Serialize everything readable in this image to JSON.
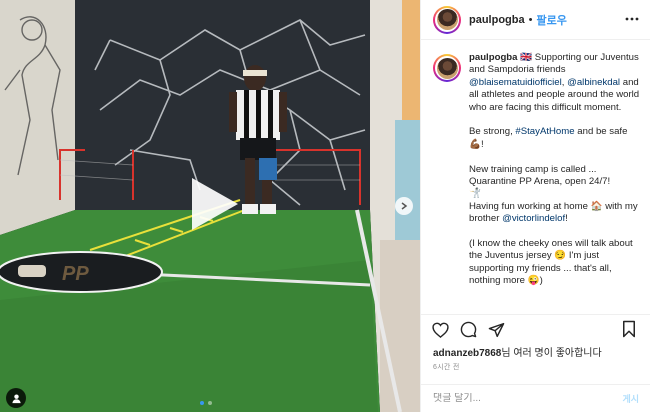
{
  "header": {
    "username": "paulpogba",
    "separator": "•",
    "follow_label": "팔로우"
  },
  "caption": {
    "username": "paulpogba",
    "intro": "Supporting our Juventus and Sampdoria friends",
    "mention1": "@blaisematuidiofficiel",
    "comma": ",",
    "mention2": "@albinekdal",
    "line1_end": "and all athletes and people around the world who are facing this difficult moment.",
    "p2_start": "Be strong,",
    "hashtag": "#StayAtHome",
    "p2_end": "and be safe 💪🏾!",
    "p3_line1": "New training camp is called ... Quarantine PP Arena, open 24/7!",
    "p3_emoji": "🤺",
    "p4_start": "Having fun working at home 🏠 with my brother",
    "mention3": "@victorlindelof",
    "p4_end": "!",
    "p5": "(I know the cheeky ones will talk about the Juventus jersey 😏 I'm just supporting my friends ... that's all, nothing more 😜)",
    "flag_emoji": "🇬🇧"
  },
  "likes": {
    "username": "adnanzeb7868",
    "suffix": "님 여러 명이 좋아합니다"
  },
  "time_label": "6시간 전",
  "comment": {
    "placeholder": "댓글 달기...",
    "post_label": "게시"
  },
  "media": {
    "carousel_total": 2,
    "carousel_active": 1
  },
  "colors": {
    "accent": "#3897f0",
    "link": "#00376b",
    "text": "#262626",
    "muted": "#8e8e8e"
  }
}
